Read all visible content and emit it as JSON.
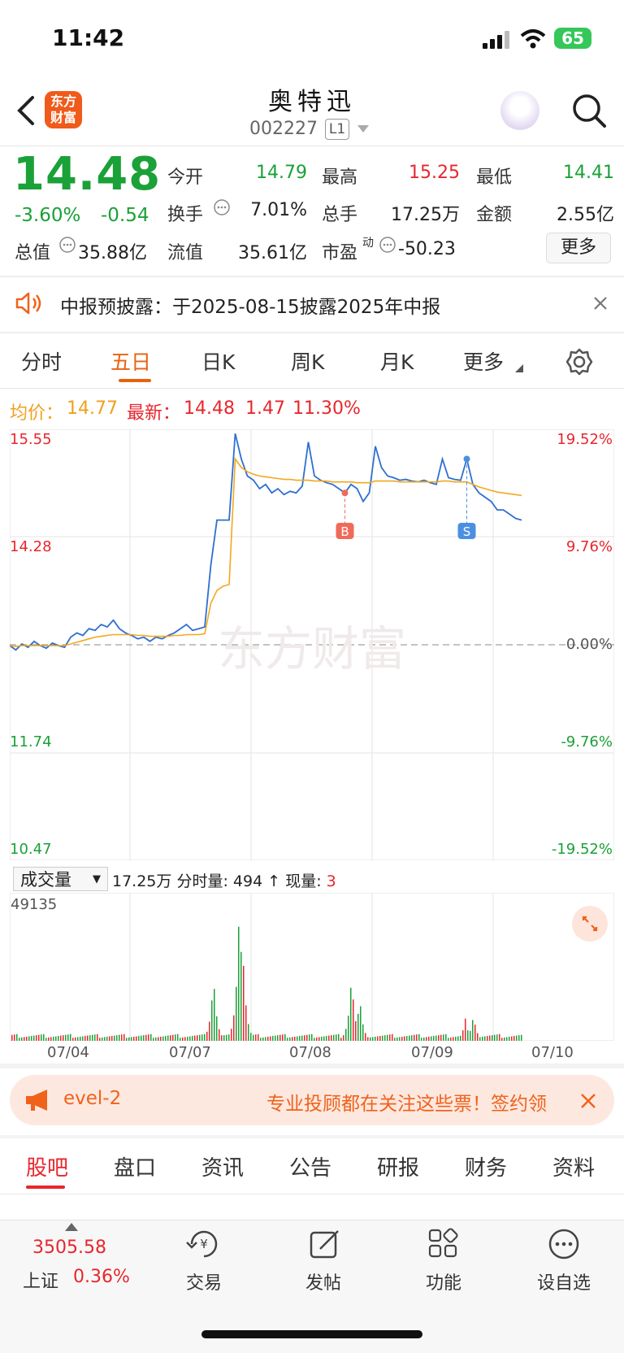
{
  "status": {
    "time": "11:42",
    "battery": "65"
  },
  "header": {
    "stock_name": "奥特迅",
    "code": "002227",
    "level": "L1",
    "logo_text": [
      "东方",
      "财富"
    ]
  },
  "quote": {
    "price": "14.48",
    "change_pct": "-3.60%",
    "change": "-0.54",
    "fields": [
      {
        "label": "今开",
        "value": "14.79",
        "color": "green"
      },
      {
        "label": "最高",
        "value": "15.25",
        "color": "red"
      },
      {
        "label": "最低",
        "value": "14.41",
        "color": "green"
      },
      {
        "label": "换手",
        "value": "7.01%",
        "color": "black"
      },
      {
        "label": "总手",
        "value": "17.25万",
        "color": "black"
      },
      {
        "label": "金额",
        "value": "2.55亿",
        "color": "black"
      },
      {
        "label": "总值",
        "value": "35.88亿",
        "color": "black"
      },
      {
        "label": "流值",
        "value": "35.61亿",
        "color": "black"
      },
      {
        "label": "市盈",
        "value": "-50.23",
        "color": "black"
      }
    ],
    "pe_superscript": "动",
    "more_label": "更多"
  },
  "notice": {
    "text": "中报预披露：于2025-08-15披露2025年中报"
  },
  "chart_tabs": [
    "分时",
    "五日",
    "日K",
    "周K",
    "月K",
    "更多"
  ],
  "chart_tabs_active": "五日",
  "chart_info": {
    "avg_label": "均价：",
    "avg_value": "14.77",
    "latest_label": "最新：",
    "latest_value": "14.48",
    "chg": "1.47",
    "chg_pct": "11.30%"
  },
  "chart_data": {
    "type": "line",
    "title": "",
    "x_labels": [
      "07/04",
      "07/07",
      "07/08",
      "07/09",
      "07/10"
    ],
    "y_ticks_left": [
      "15.55",
      "14.28",
      "",
      "11.74",
      "10.47"
    ],
    "y_ticks_right": [
      "19.52%",
      "9.76%",
      "0.00%",
      "-9.76%",
      "-19.52%"
    ],
    "ylim": [
      10.47,
      15.55
    ],
    "base": 13.01,
    "series": [
      {
        "name": "最新",
        "color": "#2f6fd0",
        "values": [
          13.0,
          12.95,
          13.02,
          12.98,
          13.05,
          13.0,
          12.97,
          13.03,
          13.0,
          12.98,
          13.1,
          13.15,
          13.12,
          13.2,
          13.18,
          13.25,
          13.22,
          13.3,
          13.2,
          13.15,
          13.12,
          13.08,
          13.1,
          13.05,
          13.1,
          13.08,
          13.12,
          13.15,
          13.2,
          13.25,
          13.18,
          13.2,
          13.22,
          13.95,
          14.48,
          14.48,
          14.48,
          15.5,
          15.2,
          15.0,
          14.95,
          14.85,
          14.9,
          14.8,
          14.85,
          14.78,
          14.82,
          14.8,
          14.88,
          15.4,
          15.0,
          14.95,
          14.92,
          14.9,
          14.85,
          14.8,
          14.9,
          14.85,
          14.7,
          14.8,
          15.35,
          15.1,
          15.0,
          14.98,
          14.95,
          14.96,
          14.94,
          14.93,
          14.95,
          14.92,
          14.9,
          15.2,
          14.98,
          14.96,
          14.95,
          15.2,
          14.9,
          14.8,
          14.75,
          14.7,
          14.6,
          14.6,
          14.55,
          14.5,
          14.48
        ]
      },
      {
        "name": "均价",
        "color": "#f2a81e",
        "values": [
          13.0,
          12.99,
          13.0,
          13.0,
          13.0,
          13.0,
          13.0,
          13.0,
          13.0,
          13.0,
          13.02,
          13.04,
          13.06,
          13.08,
          13.1,
          13.11,
          13.12,
          13.13,
          13.13,
          13.13,
          13.13,
          13.12,
          13.12,
          13.11,
          13.11,
          13.11,
          13.11,
          13.12,
          13.12,
          13.13,
          13.13,
          13.13,
          13.14,
          13.5,
          13.65,
          13.7,
          13.72,
          15.2,
          15.1,
          15.05,
          15.02,
          15.0,
          14.99,
          14.98,
          14.97,
          14.96,
          14.96,
          14.95,
          14.95,
          14.95,
          14.94,
          14.94,
          14.94,
          14.93,
          14.93,
          14.93,
          14.93,
          14.92,
          14.92,
          14.92,
          14.94,
          14.94,
          14.94,
          14.94,
          14.93,
          14.93,
          14.93,
          14.93,
          14.93,
          14.93,
          14.93,
          14.94,
          14.94,
          14.93,
          14.93,
          14.93,
          14.9,
          14.87,
          14.85,
          14.83,
          14.81,
          14.8,
          14.79,
          14.78,
          14.77
        ]
      }
    ],
    "markers": [
      {
        "label": "B",
        "color": "#f06a5a"
      },
      {
        "label": "S",
        "color": "#4a90e2"
      }
    ],
    "grid": true,
    "watermark": "东方财富",
    "volume": {
      "max_label": "49135",
      "ylim": [
        0,
        49135
      ]
    }
  },
  "volume_panel": {
    "selector": "成交量",
    "total": "17.25万",
    "tick_label": "分时量:",
    "tick_value": "494",
    "now_label": "现量:",
    "now_value": "3"
  },
  "banner": {
    "text_left": "evel-2",
    "text_right": "专业投顾都在关注这些票！签约领"
  },
  "content_tabs": [
    "股吧",
    "盘口",
    "资讯",
    "公告",
    "研报",
    "财务",
    "资料"
  ],
  "content_tabs_active": "股吧",
  "bottom_bar": {
    "index_value": "3505.58",
    "index_name": "上证",
    "index_pct": "0.36%",
    "items": [
      "交易",
      "发帖",
      "功能",
      "设自选"
    ]
  }
}
